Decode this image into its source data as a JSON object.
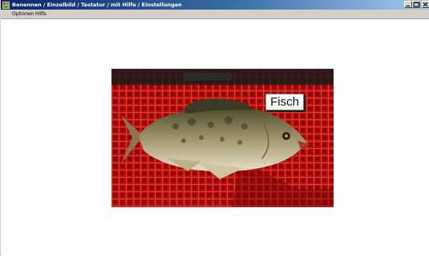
{
  "window": {
    "title": "Benennen / Einzelbild / Tastatur / mit Hilfe / Einstellungen",
    "controls": [
      "minimize-icon",
      "maximize-icon",
      "close-icon"
    ]
  },
  "menu": {
    "items": [
      {
        "label": "Optionen"
      },
      {
        "label": "Hilfe"
      }
    ]
  },
  "stimulus": {
    "image": "fish-on-red-crate",
    "label": "Fisch"
  },
  "colors": {
    "titlebar_start": "#0a246a",
    "titlebar_end": "#a6caf0",
    "chrome": "#d4d0c8",
    "crate_red": "#b10c0c"
  }
}
